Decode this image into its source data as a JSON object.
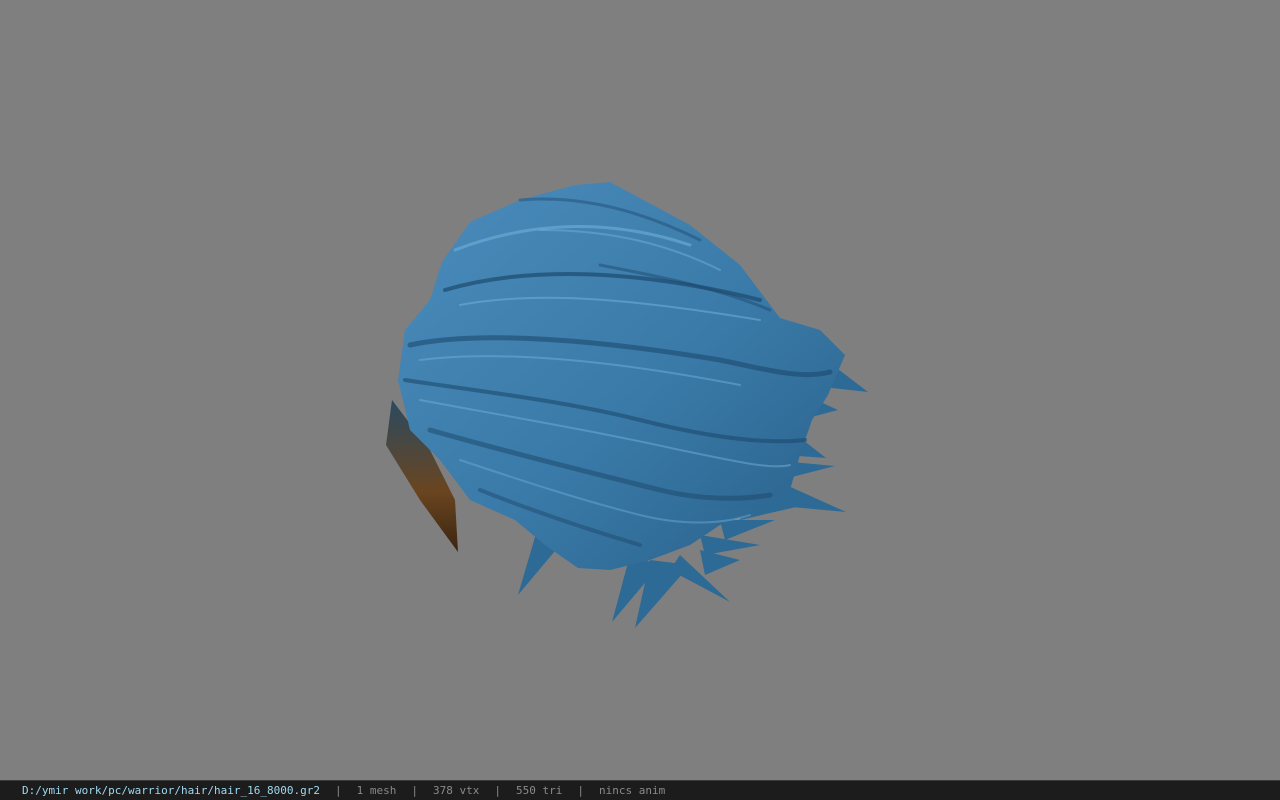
{
  "viewer": {
    "background_color": "#7f7f7f",
    "model": {
      "primary_color": "#3a7aa8",
      "highlight_color": "#6fb0d8",
      "shadow_color": "#1d4a6e",
      "root_color": "#5a3a18"
    }
  },
  "statusbar": {
    "file_path": "D:/ymir work/pc/warrior/hair/hair_16_8000.gr2",
    "separator": "|",
    "mesh_count": "1 mesh",
    "vertex_count": "378 vtx",
    "triangle_count": "550 tri",
    "anim_status": "nincs anim"
  }
}
